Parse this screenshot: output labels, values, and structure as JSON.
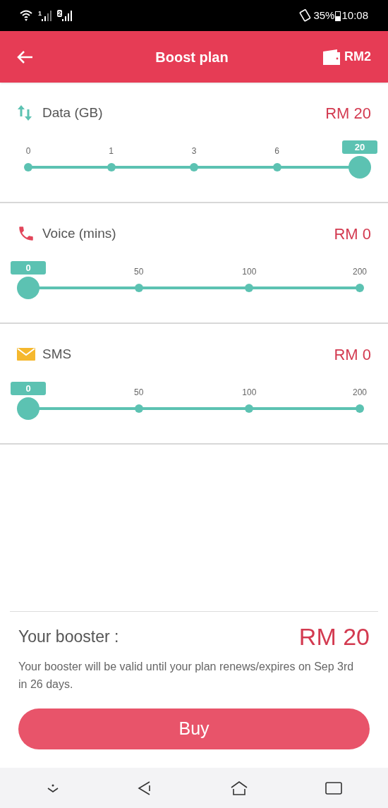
{
  "status_bar": {
    "sims": [
      "1",
      "2"
    ],
    "battery": "35%",
    "time": "10:08"
  },
  "header": {
    "title": "Boost plan",
    "balance": "RM2"
  },
  "sections": [
    {
      "kind": "data",
      "label": "Data (GB)",
      "price": "RM 20",
      "ticks": [
        "0",
        "1",
        "3",
        "6",
        "20"
      ],
      "level": 1
    },
    {
      "kind": "voice",
      "label": "Voice (mins)",
      "price": "RM 0",
      "ticks": [
        "0",
        "50",
        "100",
        "200"
      ],
      "level": 0
    },
    {
      "kind": "sms",
      "label": "SMS",
      "price": "RM 0",
      "ticks": [
        "0",
        "50",
        "100",
        "200"
      ],
      "level": 0
    }
  ],
  "summary": {
    "label": "Your booster :",
    "total": "RM 20",
    "note": "Your booster will be valid until your plan renews/expires on Sep 3rd in 26 days."
  },
  "buy_button": "Buy"
}
